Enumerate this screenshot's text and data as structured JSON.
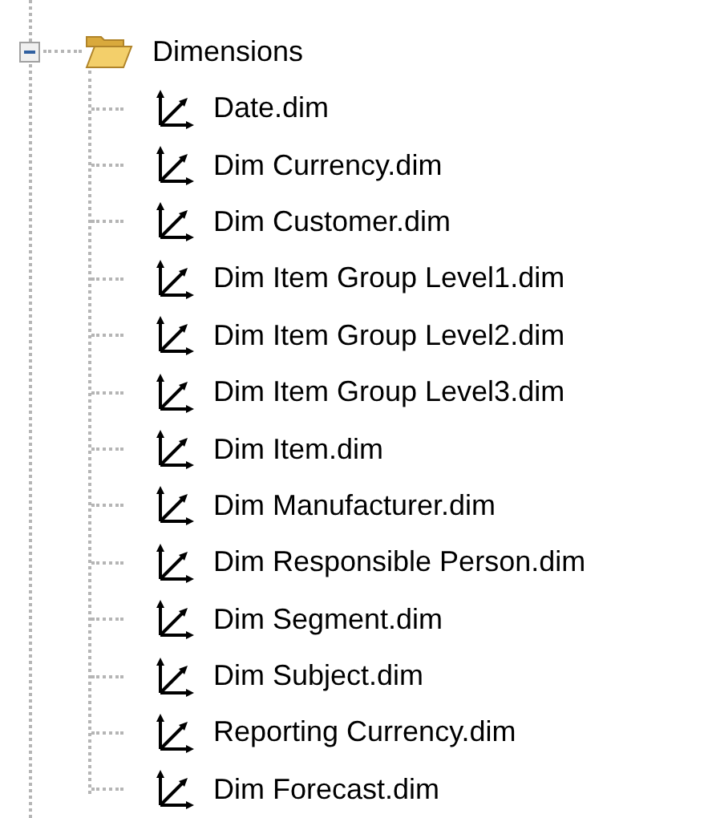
{
  "tree": {
    "label": "Dimensions",
    "expanded": true,
    "children": [
      {
        "label": "Date.dim"
      },
      {
        "label": "Dim Currency.dim"
      },
      {
        "label": "Dim Customer.dim"
      },
      {
        "label": "Dim Item Group Level1.dim"
      },
      {
        "label": "Dim Item Group Level2.dim"
      },
      {
        "label": "Dim Item Group Level3.dim"
      },
      {
        "label": "Dim Item.dim"
      },
      {
        "label": "Dim Manufacturer.dim"
      },
      {
        "label": "Dim Responsible Person.dim"
      },
      {
        "label": "Dim Segment.dim"
      },
      {
        "label": "Dim Subject.dim"
      },
      {
        "label": "Reporting Currency.dim"
      },
      {
        "label": "Dim Forecast.dim"
      }
    ]
  }
}
